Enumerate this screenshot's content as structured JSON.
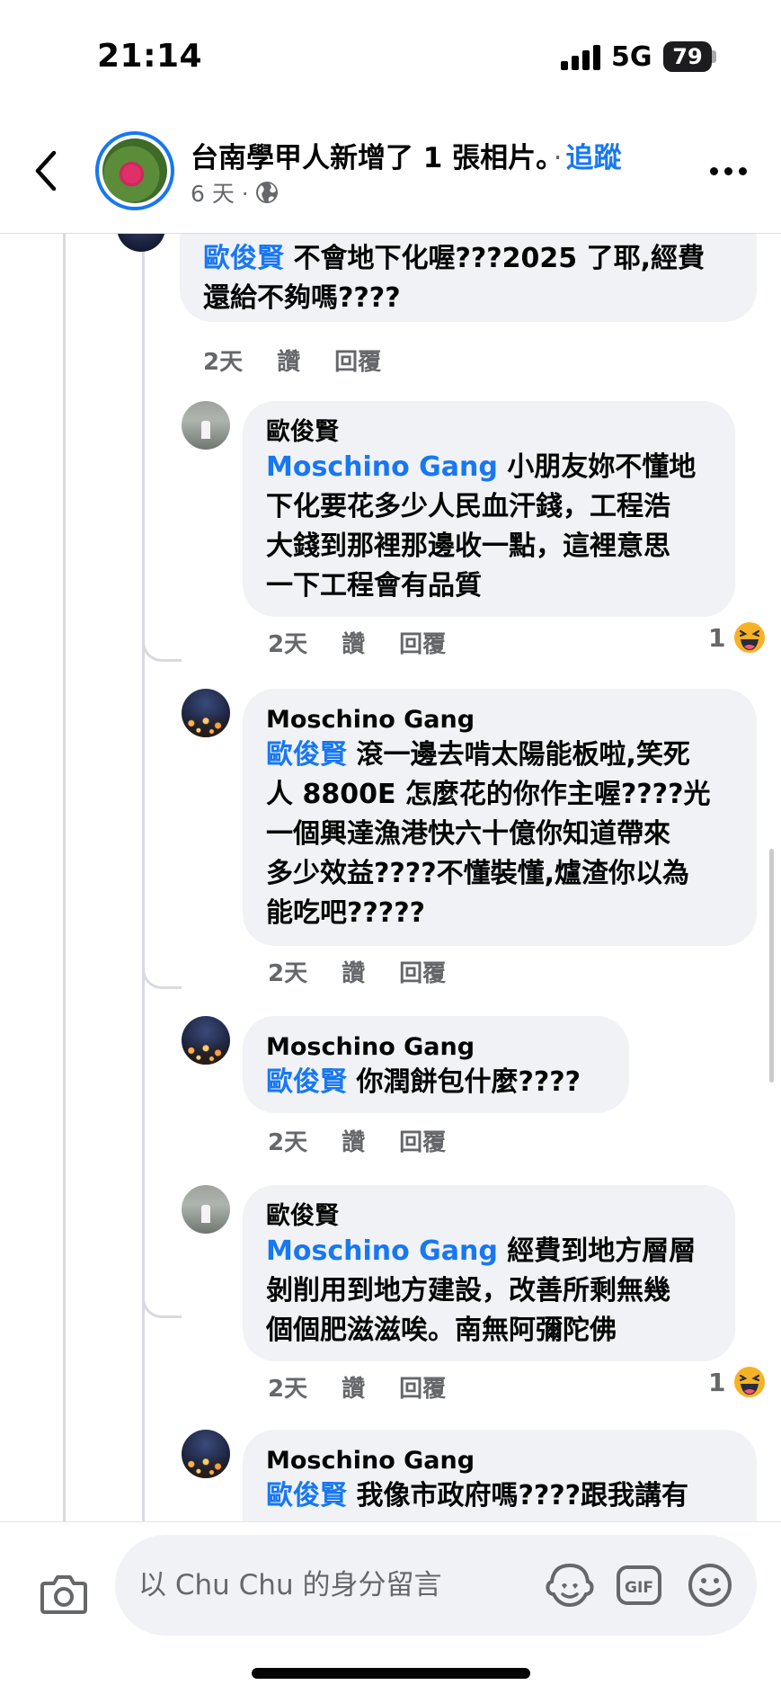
{
  "status_bar": {
    "time": "21:14",
    "network": "5G",
    "battery": "79"
  },
  "header": {
    "page_name": "台南學甲人新增了 1 張相片。",
    "dot": "·",
    "follow_label": "追蹤",
    "time_ago": "6 天 ·",
    "back_icon": "chevron-left-icon",
    "more_icon": "more-horizontal-icon"
  },
  "comments": [
    {
      "author": "",
      "mention": "歐俊賢",
      "lines": [
        " 不會地下化喔???2025 了耶,經費",
        "還給不夠嗎????"
      ],
      "time": "2天",
      "like": "讚",
      "reply": "回覆",
      "reaction_count": ""
    },
    {
      "author": "歐俊賢",
      "mention": "Moschino Gang",
      "lines": [
        " 小朋友妳不懂地",
        "下化要花多少人民血汗錢，工程浩",
        "大錢到那裡那邊收一點，這裡意思",
        "一下工程會有品質"
      ],
      "time": "2天",
      "like": "讚",
      "reply": "回覆",
      "reaction_count": "1"
    },
    {
      "author": "Moschino Gang",
      "mention": "歐俊賢",
      "lines": [
        " 滾一邊去啃太陽能板啦,笑死",
        "人 8800E 怎麼花的你作主喔????光",
        "一個興達漁港快六十億你知道帶來",
        "多少效益????不懂裝懂,爐渣你以為",
        "能吃吧?????"
      ],
      "time": "2天",
      "like": "讚",
      "reply": "回覆",
      "reaction_count": ""
    },
    {
      "author": "Moschino Gang",
      "mention": "歐俊賢",
      "lines": [
        " 你潤餅包什麼????"
      ],
      "time": "2天",
      "like": "讚",
      "reply": "回覆",
      "reaction_count": ""
    },
    {
      "author": "歐俊賢",
      "mention": "Moschino Gang",
      "lines": [
        " 經費到地方層層",
        "剝削用到地方建設，改善所剩無幾",
        "個個肥滋滋唉。南無阿彌陀佛"
      ],
      "time": "2天",
      "like": "讚",
      "reply": "回覆",
      "reaction_count": "1"
    },
    {
      "author": "Moschino Gang",
      "mention": "歐俊賢",
      "lines": [
        " 我像市政府嗎????跟我講有"
      ],
      "time": "",
      "like": "",
      "reply": "",
      "reaction_count": ""
    }
  ],
  "composer": {
    "placeholder": "以 Chu Chu 的身分留言",
    "gif_label": "GIF",
    "icons": [
      "camera-icon",
      "avatar-sticker-icon",
      "gif-icon",
      "emoji-icon"
    ]
  },
  "colors": {
    "accent": "#1877f2",
    "bubble": "#f0f2f5",
    "muted": "#65676b"
  }
}
